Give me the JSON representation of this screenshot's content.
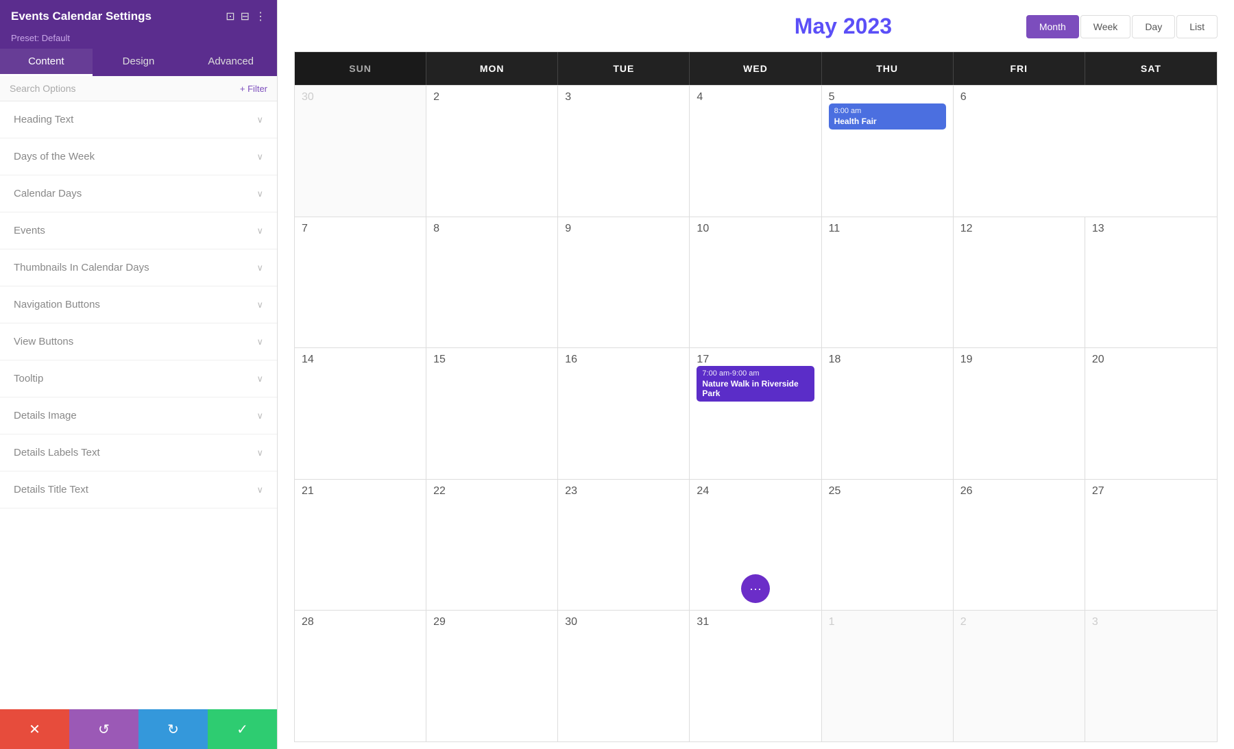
{
  "panel": {
    "title": "Events Calendar Settings",
    "preset_label": "Preset: Default",
    "tabs": [
      {
        "label": "Content",
        "active": true
      },
      {
        "label": "Design",
        "active": false
      },
      {
        "label": "Advanced",
        "active": false
      }
    ],
    "search_placeholder": "Search Options",
    "filter_label": "+ Filter",
    "items": [
      {
        "label": "Heading Text"
      },
      {
        "label": "Days of the Week"
      },
      {
        "label": "Calendar Days"
      },
      {
        "label": "Events"
      },
      {
        "label": "Thumbnails In Calendar Days"
      },
      {
        "label": "Navigation Buttons"
      },
      {
        "label": "View Buttons"
      },
      {
        "label": "Tooltip"
      },
      {
        "label": "Details Image"
      },
      {
        "label": "Details Labels Text"
      },
      {
        "label": "Details Title Text"
      }
    ]
  },
  "toolbar": {
    "cancel_icon": "✕",
    "undo_icon": "↺",
    "redo_icon": "↻",
    "save_icon": "✓"
  },
  "calendar": {
    "title": "May 2023",
    "view_buttons": [
      {
        "label": "Month",
        "active": true
      },
      {
        "label": "Week",
        "active": false
      },
      {
        "label": "Day",
        "active": false
      },
      {
        "label": "List",
        "active": false
      }
    ],
    "day_names": [
      "MON",
      "TUE",
      "WED",
      "THU",
      "FRI",
      "SAT"
    ],
    "weeks": [
      {
        "cells": [
          {
            "num": "",
            "dim": true
          },
          {
            "num": "2"
          },
          {
            "num": "3"
          },
          {
            "num": "4"
          },
          {
            "num": "5",
            "event": {
              "time": "8:00 am",
              "name": "Health Fair",
              "color": "blue"
            }
          },
          {
            "num": "6"
          }
        ]
      },
      {
        "cells": [
          {
            "num": "8"
          },
          {
            "num": "9"
          },
          {
            "num": "10"
          },
          {
            "num": "11"
          },
          {
            "num": "12"
          },
          {
            "num": "13"
          }
        ]
      },
      {
        "cells": [
          {
            "num": "15"
          },
          {
            "num": "16"
          },
          {
            "num": "17",
            "event": {
              "time": "7:00 am-9:00 am",
              "name": "Nature Walk in Riverside Park",
              "color": "purple"
            }
          },
          {
            "num": "18"
          },
          {
            "num": "19"
          },
          {
            "num": "20"
          }
        ]
      },
      {
        "cells": [
          {
            "num": "22"
          },
          {
            "num": "23"
          },
          {
            "num": "24",
            "hasDot": true
          },
          {
            "num": "25"
          },
          {
            "num": "26"
          },
          {
            "num": "27"
          }
        ]
      },
      {
        "cells": [
          {
            "num": "29"
          },
          {
            "num": "30"
          },
          {
            "num": "31"
          },
          {
            "num": "1",
            "dim": true
          },
          {
            "num": "2",
            "dim": true
          },
          {
            "num": "3",
            "dim": true
          }
        ]
      }
    ]
  }
}
